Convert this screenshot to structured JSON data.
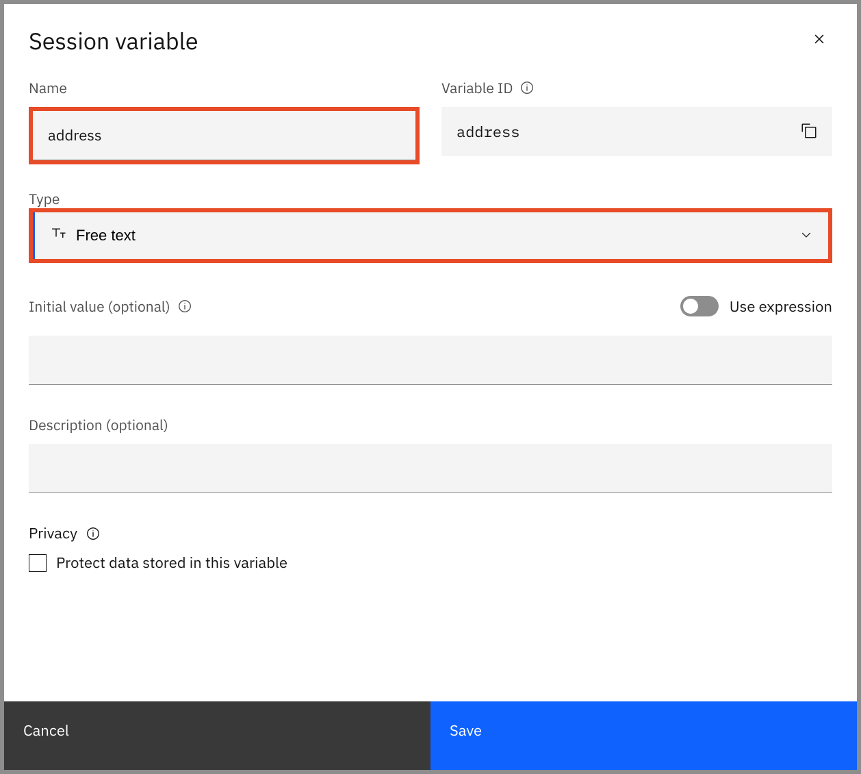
{
  "modal": {
    "title": "Session variable",
    "name_label": "Name",
    "name_value": "address",
    "variable_id_label": "Variable ID",
    "variable_id_value": "address",
    "type_label": "Type",
    "type_value": "Free text",
    "initial_value_label": "Initial value (optional)",
    "initial_value": "",
    "use_expression_label": "Use expression",
    "description_label": "Description (optional)",
    "description_value": "",
    "privacy_label": "Privacy",
    "privacy_checkbox_label": "Protect data stored in this variable",
    "cancel_label": "Cancel",
    "save_label": "Save"
  }
}
